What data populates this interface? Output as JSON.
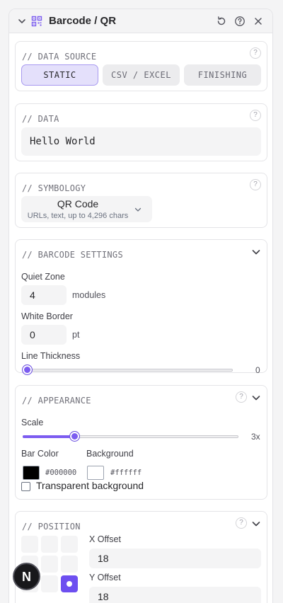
{
  "header": {
    "title": "Barcode / QR",
    "collapse_icon": "chevron-down-icon",
    "widget_icon": "qr-code-icon",
    "actions": [
      "reset-icon",
      "help-icon",
      "close-icon"
    ]
  },
  "colors": {
    "accent": "#7c5cf0",
    "accent_soft": "#e4e0fb"
  },
  "data_source": {
    "title": "// DATA SOURCE",
    "help": "?",
    "options": [
      "STATIC",
      "CSV / EXCEL",
      "FINISHING"
    ],
    "selected": "STATIC"
  },
  "data": {
    "title": "// DATA",
    "help": "?",
    "value": "Hello World"
  },
  "symbology": {
    "title": "// SYMBOLOGY",
    "help": "?",
    "selected": "QR Code",
    "description": "URLs, text, up to 4,296 chars"
  },
  "barcode_settings": {
    "title": "// BARCODE SETTINGS",
    "quiet_zone": {
      "label": "Quiet Zone",
      "value": "4",
      "unit": "modules"
    },
    "white_border": {
      "label": "White Border",
      "value": "0",
      "unit": "pt"
    },
    "line_thickness": {
      "label": "Line Thickness",
      "value": 0,
      "display": "0"
    }
  },
  "appearance": {
    "title": "// APPEARANCE",
    "help": "?",
    "scale": {
      "label": "Scale",
      "value": 3,
      "display": "3x",
      "fraction": 0.24
    },
    "bar_color": {
      "label": "Bar Color",
      "hex": "#000000"
    },
    "background": {
      "label": "Background",
      "hex": "#ffffff"
    },
    "transparent": {
      "label": "Transparent background",
      "checked": false
    }
  },
  "position": {
    "title": "// POSITION",
    "help": "?",
    "anchor_selected": "bottom-right",
    "x_offset": {
      "label": "X Offset",
      "value": "18"
    },
    "y_offset": {
      "label": "Y Offset",
      "value": "18"
    }
  },
  "fab": {
    "letter": "N"
  }
}
